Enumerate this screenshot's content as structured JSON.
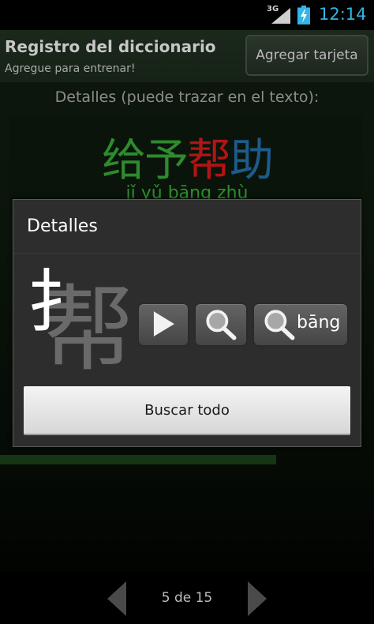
{
  "status_bar": {
    "network": "3G",
    "time": "12:14"
  },
  "header": {
    "title": "Registro del diccionario",
    "subtitle": "Agregue para entrenar!",
    "add_card_label": "Agregar tarjeta"
  },
  "details_hint": "Detalles (puede trazar en el texto):",
  "word": {
    "chars": [
      {
        "char": "给",
        "color": "#2e8b2e"
      },
      {
        "char": "予",
        "color": "#2e8b2e"
      },
      {
        "char": "帮",
        "color": "#b01515"
      },
      {
        "char": "助",
        "color": "#1d5b8c"
      }
    ],
    "pinyin": "jǐ yǔ bāng zhù"
  },
  "dialog": {
    "title": "Detalles",
    "char_main": "帮",
    "char_radical": "扌",
    "search_pinyin_label": "bāng",
    "search_all_label": "Buscar todo"
  },
  "navigation": {
    "page_indicator": "5 de 15"
  },
  "icons": {
    "prev": "chevron-left-icon",
    "next": "chevron-right-icon",
    "play": "play-icon",
    "search": "magnifier-icon",
    "battery": "battery-charging-icon",
    "signal": "signal-icon"
  },
  "colors": {
    "accent_blue": "#33b5e5",
    "app_background": "#0e180e"
  }
}
